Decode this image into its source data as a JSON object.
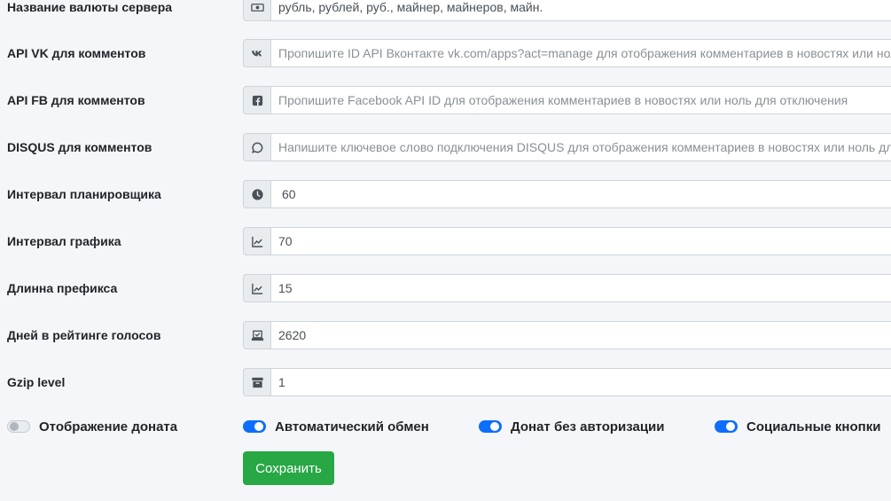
{
  "fields": [
    {
      "label": "Название валюты сервера",
      "icon": "money-icon",
      "value": "рубль, рублей, руб., майнер, майнеров, майн.",
      "placeholder": ""
    },
    {
      "label": "API VK для комментов",
      "icon": "vk-icon",
      "value": "",
      "placeholder": "Пропишите ID API Вконтакте vk.com/apps?act=manage для отображения комментариев в новостях или ноль для отключения"
    },
    {
      "label": "API FB для комментов",
      "icon": "facebook-icon",
      "value": "",
      "placeholder": "Пропишите Facebook API ID для отображения комментариев в новостях или ноль для отключения"
    },
    {
      "label": "DISQUS для комментов",
      "icon": "comment-icon",
      "value": "",
      "placeholder": "Напишите ключевое слово подключения DISQUS для отображения комментариев в новостях или ноль для отключения"
    },
    {
      "label": "Интервал планировщика",
      "icon": "clock-icon",
      "value": "60",
      "placeholder": ""
    },
    {
      "label": "Интервал графика",
      "icon": "chart-icon",
      "value": "70",
      "placeholder": ""
    },
    {
      "label": "Длинна префикса",
      "icon": "chart-icon",
      "value": "15",
      "placeholder": ""
    },
    {
      "label": "Дней в рейтинге голосов",
      "icon": "vote-icon",
      "value": "2620",
      "placeholder": ""
    },
    {
      "label": "Gzip level",
      "icon": "archive-icon",
      "value": "1",
      "placeholder": ""
    }
  ],
  "toggles": [
    {
      "label": "Отображение доната",
      "checked": false
    },
    {
      "label": "Автоматический обмен",
      "checked": true
    },
    {
      "label": "Донат без авторизации",
      "checked": true
    },
    {
      "label": "Социальные кнопки",
      "checked": true
    }
  ],
  "save_label": "Сохранить",
  "colors": {
    "accent": "#0d6efd",
    "success": "#28a745",
    "background": "#f4f6f9"
  }
}
